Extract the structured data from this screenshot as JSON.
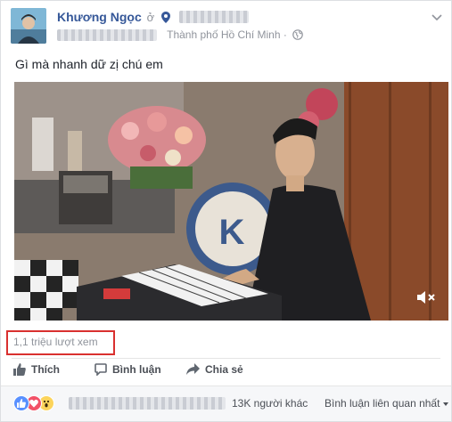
{
  "post": {
    "author": "Khương Ngọc",
    "at_word": "ở",
    "location": "Thành phố Hồ Chí Minh",
    "separator": "·",
    "text": "Gì mà nhanh dữ zị chú em"
  },
  "video": {
    "muted": true,
    "views": "1,1 triệu lượt xem"
  },
  "actions": {
    "like": "Thích",
    "comment": "Bình luận",
    "share": "Chia sẻ"
  },
  "reactions": {
    "types": [
      "like",
      "love",
      "wow"
    ],
    "others": "13K người khác",
    "sort_label": "Bình luận liên quan nhất"
  },
  "colors": {
    "author": "#365899",
    "views_highlight": "#d9302f",
    "like_blue": "#5890ff",
    "love_red": "#f25268",
    "wow_yellow": "#fcd45b"
  }
}
